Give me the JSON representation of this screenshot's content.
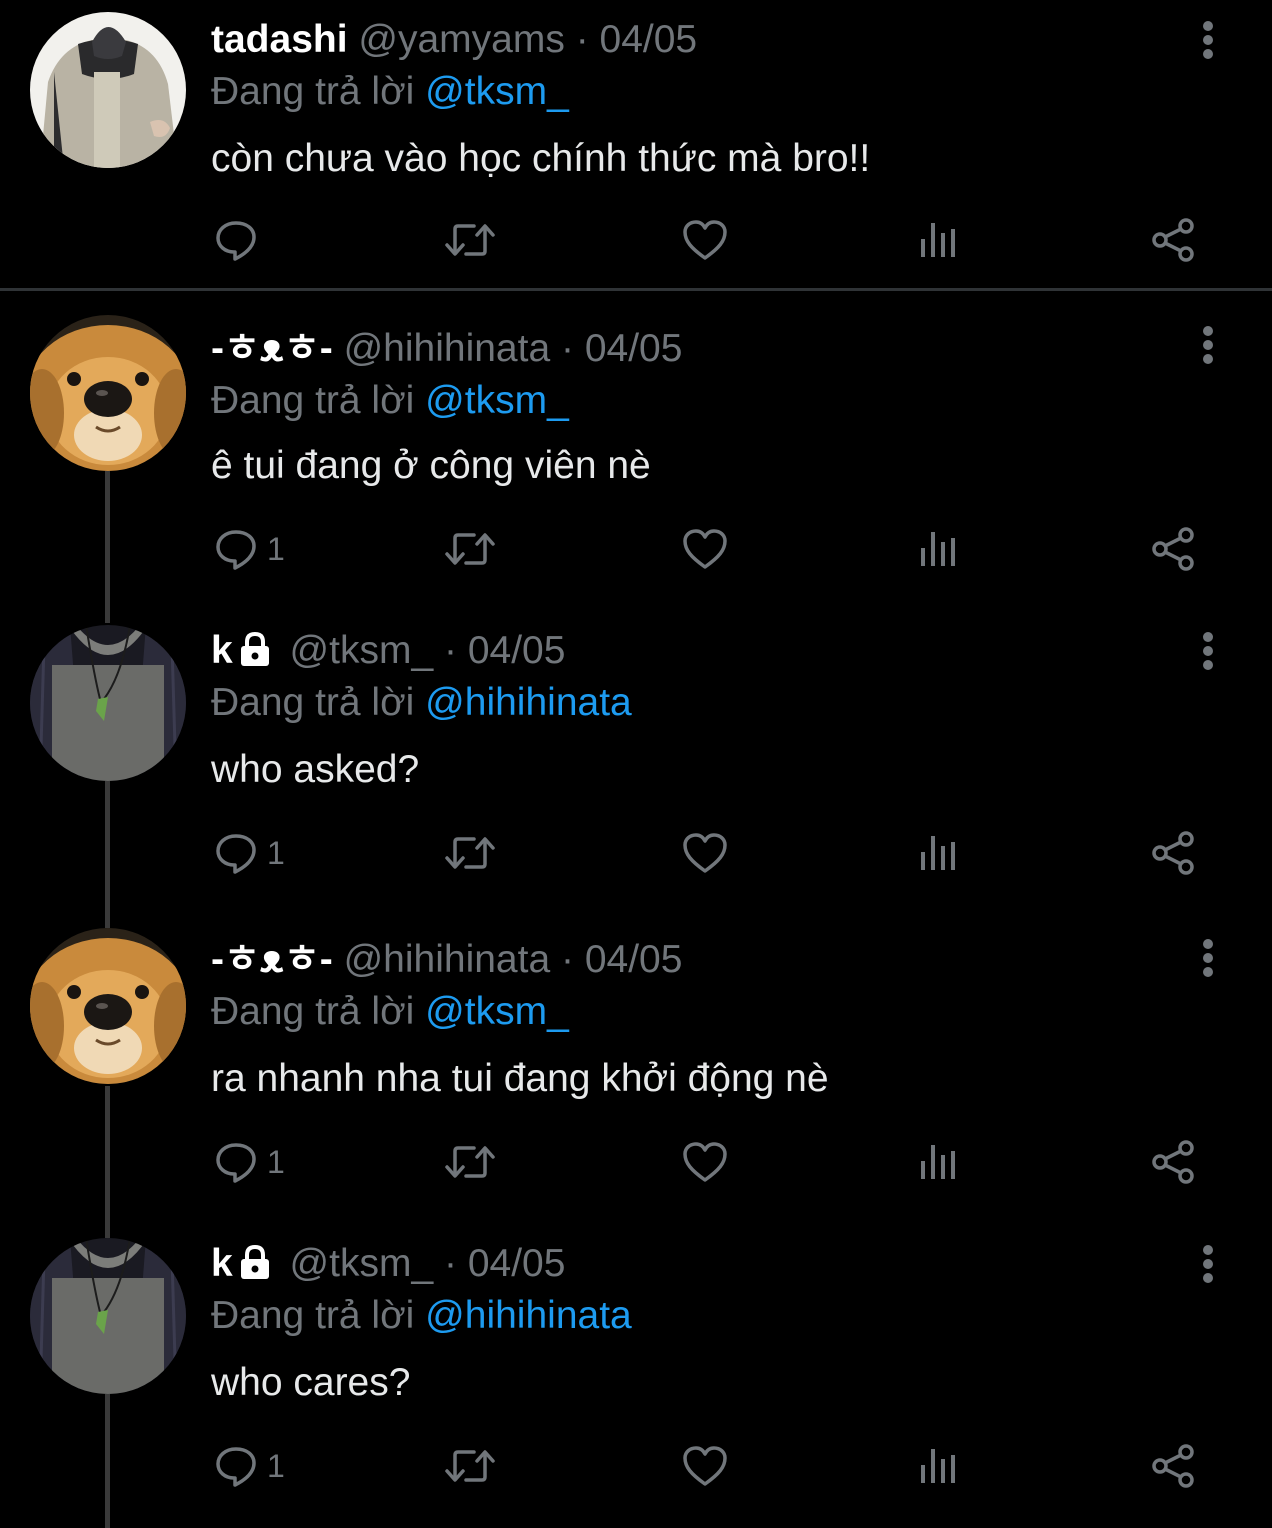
{
  "colors": {
    "background": "#000000",
    "text": "#e7e9ea",
    "muted": "#71767b",
    "accent": "#1d9bf0",
    "divider": "#2f3336"
  },
  "replying_to_label": "Đang trả lời",
  "separator": "·",
  "tweets": [
    {
      "display_name": "tadashi",
      "handle": "@yamyams",
      "date": "04/05",
      "reply_to": "@tksm_",
      "text": "còn chưa vào học chính thức mà bro!!",
      "reply_count": "",
      "avatar": "photo-person-jacket",
      "locked": false
    },
    {
      "display_name": "-ㅎᴥㅎ-",
      "handle": "@hihihinata",
      "date": "04/05",
      "reply_to": "@tksm_",
      "text": "ê tui đang ở công viên nè",
      "reply_count": "1",
      "avatar": "photo-golden-retriever",
      "locked": false
    },
    {
      "display_name": "k",
      "handle": "@tksm_",
      "date": "04/05",
      "reply_to": "@hihihinata",
      "text": "who asked?",
      "reply_count": "1",
      "avatar": "photo-gray-shirt-necklace",
      "locked": true
    },
    {
      "display_name": "-ㅎᴥㅎ-",
      "handle": "@hihihinata",
      "date": "04/05",
      "reply_to": "@tksm_",
      "text": "ra nhanh nha tui đang khởi động nè",
      "reply_count": "1",
      "avatar": "photo-golden-retriever",
      "locked": false
    },
    {
      "display_name": "k",
      "handle": "@tksm_",
      "date": "04/05",
      "reply_to": "@hihihinata",
      "text": "who cares?",
      "reply_count": "1",
      "avatar": "photo-gray-shirt-necklace",
      "locked": true
    }
  ],
  "action_icons": [
    "reply-icon",
    "retweet-icon",
    "like-icon",
    "views-icon",
    "share-icon"
  ]
}
